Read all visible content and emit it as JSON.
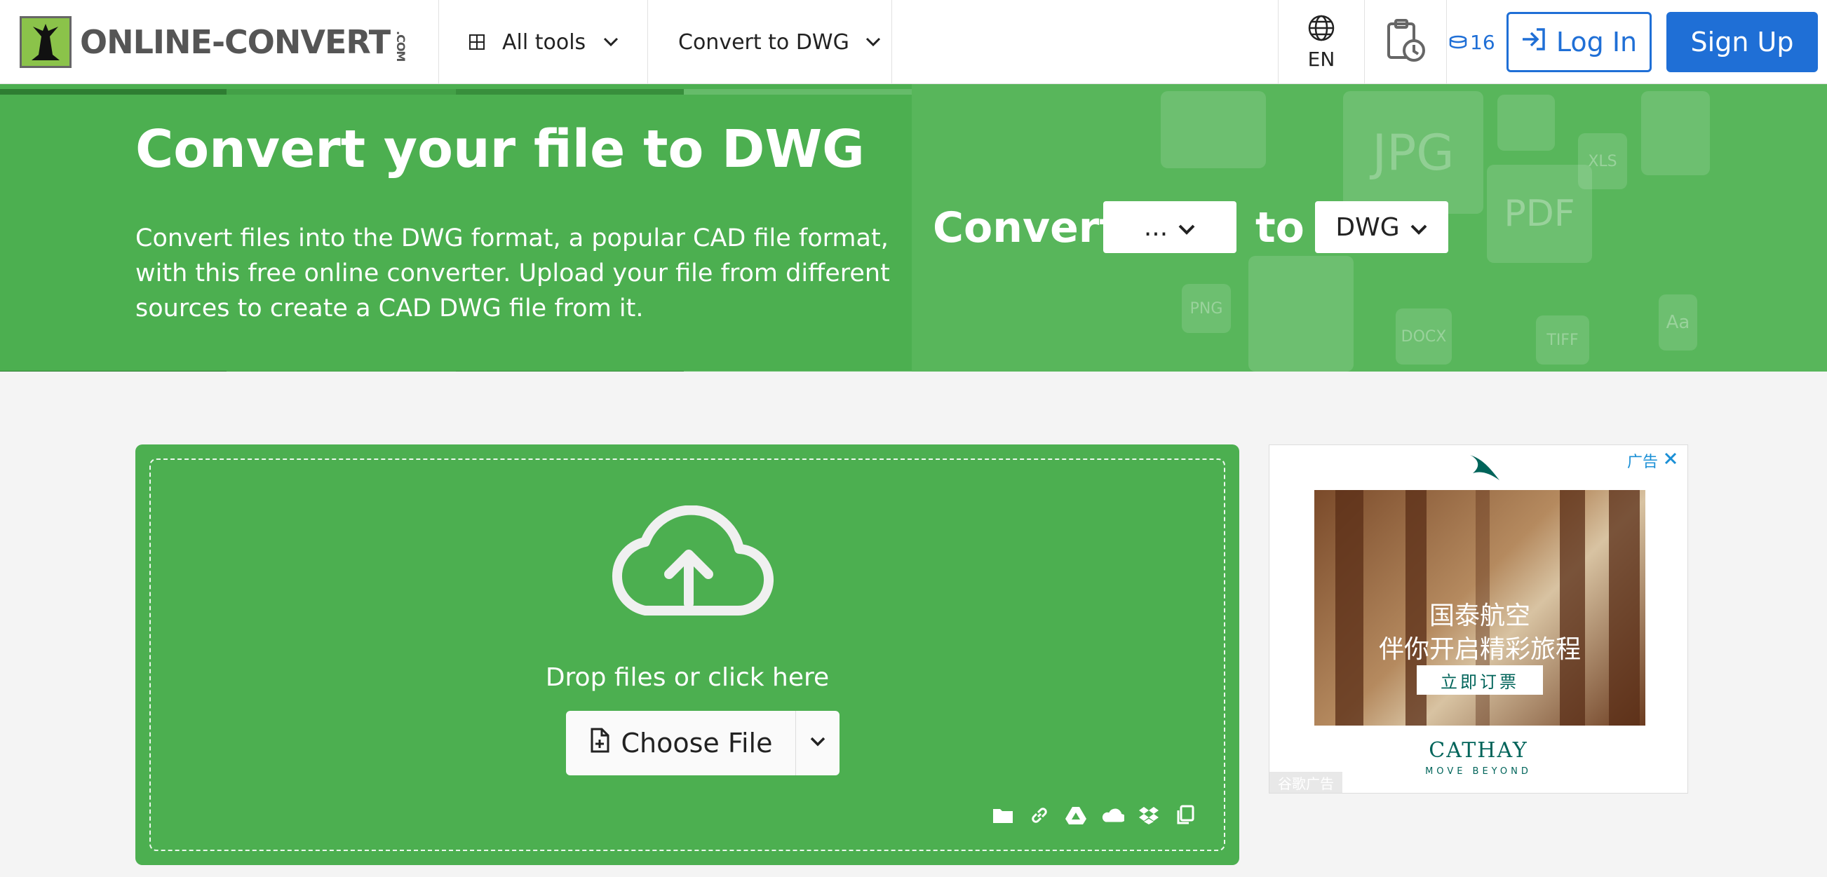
{
  "header": {
    "logo_text": "ONLINE-CONVERT",
    "logo_suffix": ".COM",
    "all_tools_label": "All tools",
    "convert_to_label": "Convert to DWG",
    "language_label": "EN",
    "credits_count": "16",
    "login_label": "Log In",
    "signup_label": "Sign Up"
  },
  "hero": {
    "title": "Convert your file to DWG",
    "description": "Convert files into the DWG format, a popular CAD file format, with this free online converter. Upload your file from different sources to create a CAD DWG file from it.",
    "convert_word": "Convert",
    "from_value": "...",
    "to_word": "to",
    "to_value": "DWG",
    "bg_labels": [
      "JPG",
      "PDF",
      "XLS",
      "PNG",
      "DOCX",
      "TIFF",
      "Aa"
    ]
  },
  "upload": {
    "drop_text": "Drop files or click here",
    "choose_label": "Choose File",
    "source_icons": [
      "folder-icon",
      "link-icon",
      "google-drive-icon",
      "onedrive-icon",
      "dropbox-icon",
      "clipboard-icon"
    ]
  },
  "ad": {
    "ad_label": "广告",
    "headline_1": "国泰航空",
    "headline_2": "伴你开启精彩旅程",
    "cta": "立即订票",
    "brand": "CATHAY",
    "tagline": "MOVE BEYOND",
    "footer": "谷歌广告"
  },
  "colors": {
    "brand_green": "#4caf50",
    "accent_blue": "#1f6fd6",
    "cathay_teal": "#00645a"
  }
}
